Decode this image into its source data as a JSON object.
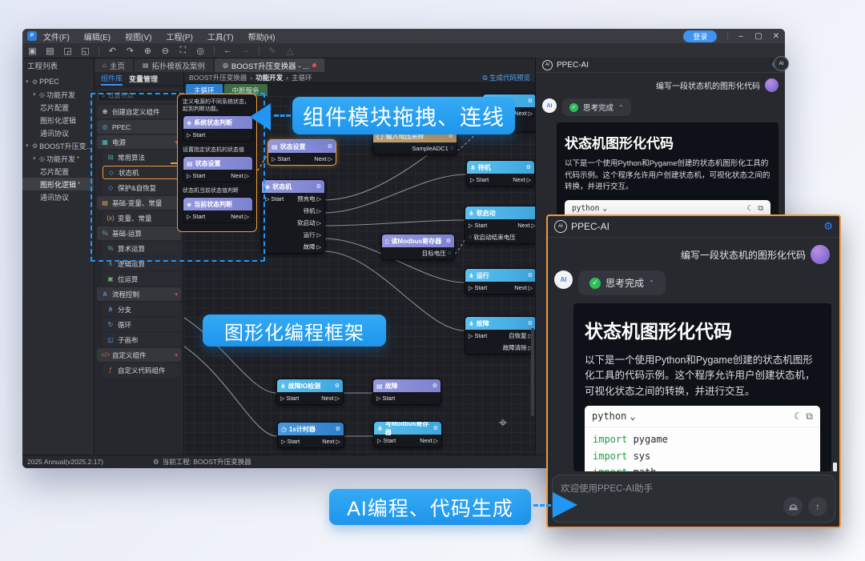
{
  "chrome": {
    "logo": "P",
    "menus": [
      "文件(F)",
      "编辑(E)",
      "视图(V)",
      "工程(P)",
      "工具(T)",
      "帮助(H)"
    ],
    "login_label": "登录",
    "window_controls": {
      "minimize": "–",
      "maximize": "▢",
      "close": "✕"
    }
  },
  "toolbar": {
    "icons": [
      {
        "name": "new-project-icon",
        "glyph": "▣"
      },
      {
        "name": "open-project-icon",
        "glyph": "▤"
      },
      {
        "name": "import-icon",
        "glyph": "◲"
      },
      {
        "name": "export-icon",
        "glyph": "◱"
      },
      {
        "name": "separator",
        "glyph": "|"
      },
      {
        "name": "undo-icon",
        "glyph": "↶"
      },
      {
        "name": "redo-icon",
        "glyph": "↷"
      },
      {
        "name": "zoom-in-icon",
        "glyph": "⊕"
      },
      {
        "name": "zoom-out-icon",
        "glyph": "⊖"
      },
      {
        "name": "fit-view-icon",
        "glyph": "⛶"
      },
      {
        "name": "locate-icon",
        "glyph": "◎"
      },
      {
        "name": "separator",
        "glyph": "|"
      },
      {
        "name": "back-icon",
        "glyph": "←"
      },
      {
        "name": "forward-icon",
        "glyph": "→",
        "disabled": true
      },
      {
        "name": "separator",
        "glyph": "|"
      },
      {
        "name": "annotate-icon",
        "glyph": "✎",
        "disabled": true
      },
      {
        "name": "measure-icon",
        "glyph": "△",
        "disabled": true
      }
    ]
  },
  "tabs": [
    {
      "label": "主页",
      "icon": "⌂"
    },
    {
      "label": "拓扑模板及案例",
      "icon": "▤"
    },
    {
      "label": "BOOST升压变换器 - ...",
      "icon": "◎",
      "active": true,
      "modified": true
    }
  ],
  "project_panel": {
    "title": "工程列表",
    "tree": [
      {
        "label": "PPEC",
        "level": 0,
        "arrow": "▾",
        "icon": "⚙"
      },
      {
        "label": "功能开发",
        "level": 1,
        "arrow": "▾",
        "icon": "◎"
      },
      {
        "label": "芯片配置",
        "level": 2
      },
      {
        "label": "图形化逻辑",
        "level": 2
      },
      {
        "label": "通讯协议",
        "level": 2
      },
      {
        "label": "BOOST升压变...",
        "level": 0,
        "arrow": "▾",
        "icon": "⚙"
      },
      {
        "label": "功能开发",
        "level": 1,
        "arrow": "▾",
        "icon": "◎",
        "modified": true
      },
      {
        "label": "芯片配置",
        "level": 2
      },
      {
        "label": "图形化逻辑",
        "level": 2,
        "modified": true,
        "active": true
      },
      {
        "label": "通讯协议",
        "level": 2
      }
    ]
  },
  "component_panel": {
    "tabs": {
      "library": "组件库",
      "variables": "变量管理"
    },
    "search_placeholder": "过滤节点",
    "items": [
      {
        "label": "创建自定义组件",
        "kind": "action",
        "icon": "⊕",
        "color": "c-white"
      },
      {
        "label": "PPEC",
        "kind": "group",
        "icon": "◎",
        "color": "c-blue"
      },
      {
        "label": "电源",
        "kind": "group",
        "icon": "▦",
        "color": "c-teal",
        "collapse": true
      },
      {
        "label": "常用算法",
        "kind": "item",
        "icon": "⊟",
        "color": "c-teal"
      },
      {
        "label": "状态机",
        "kind": "item",
        "icon": "◇",
        "color": "c-blue",
        "selected": true
      },
      {
        "label": "保护&自恢复",
        "kind": "item",
        "icon": "◇",
        "color": "c-blue"
      },
      {
        "label": "基础-变量、常量",
        "kind": "group",
        "icon": "▤",
        "color": "c-orange"
      },
      {
        "label": "变量、常量",
        "kind": "item",
        "icon": "(x)",
        "color": "c-orange"
      },
      {
        "label": "基础-运算",
        "kind": "group",
        "icon": "%",
        "color": "c-green"
      },
      {
        "label": "算术运算",
        "kind": "item",
        "icon": "%",
        "color": "c-green"
      },
      {
        "label": "逻辑运算",
        "kind": "item",
        "icon": "∧",
        "color": "c-green"
      },
      {
        "label": "位运算",
        "kind": "item",
        "icon": "▣",
        "color": "c-green"
      },
      {
        "label": "流程控制",
        "kind": "group",
        "icon": "⋔",
        "color": "c-blue",
        "collapse": true
      },
      {
        "label": "分支",
        "kind": "item",
        "icon": "⋔",
        "color": "c-blue"
      },
      {
        "label": "循环",
        "kind": "item",
        "icon": "↻",
        "color": "c-blue"
      },
      {
        "label": "子画布",
        "kind": "item",
        "icon": "◱",
        "color": "c-blue"
      },
      {
        "label": "自定义组件",
        "kind": "group",
        "icon": "</>",
        "color": "c-red",
        "collapse": true
      },
      {
        "label": "自定义代码组件",
        "kind": "item",
        "icon": "ƒ",
        "color": "c-red"
      }
    ]
  },
  "popup": {
    "sections": [
      {
        "desc": "定义电源的不同系统状态，起到判断功能。",
        "node": {
          "title": "系统状态判断",
          "theme": "purple",
          "icon": "◈",
          "rows": [
            {
              "l": "Start"
            }
          ]
        }
      },
      {
        "desc": "设置指定状态机的状态值",
        "node": {
          "title": "状态设置",
          "theme": "purple",
          "icon": "▤",
          "rows": [
            {
              "l": "Start",
              "r": "Next"
            }
          ]
        }
      },
      {
        "desc": "状态机当前状态值判断",
        "node": {
          "title": "当前状态判断",
          "theme": "purple",
          "icon": "◈",
          "rows": [
            {
              "l": "Start",
              "r": "Next"
            }
          ]
        }
      }
    ]
  },
  "canvas": {
    "breadcrumb": [
      "BOOST升压变换器",
      "功能开发",
      "主循环"
    ],
    "preview_link": "生成代码预览",
    "page_tabs": [
      {
        "label": "主循环",
        "color": "blue",
        "active": true
      },
      {
        "label": "中断服务",
        "color": "green"
      }
    ],
    "nodes": [
      {
        "id": "state-set",
        "title": "状态设置",
        "theme": "purple",
        "icon": "▤",
        "selected": true,
        "gear": true,
        "rows": [
          {
            "l": "Start",
            "r": "Next"
          }
        ]
      },
      {
        "id": "state-machine",
        "title": "状态机",
        "theme": "purple",
        "icon": "◈",
        "gear": true,
        "rows": [
          {
            "l": "Start",
            "r": "预充电"
          },
          {
            "r": "待机"
          },
          {
            "r": "软启动"
          },
          {
            "r": "运行"
          },
          {
            "r": "故障"
          }
        ]
      },
      {
        "id": "input-voltage-sample",
        "title": "输入电压采样",
        "theme": "orange",
        "icon": "{ }",
        "gear": true,
        "rows": [
          {
            "out": "SampleADC1"
          }
        ]
      },
      {
        "id": "partial-node",
        "title": "",
        "theme": "cyan",
        "icon": "",
        "gear": true,
        "rows": [
          {
            "r": "Next"
          },
          {
            "in": ""
          }
        ]
      },
      {
        "id": "standby",
        "title": "待机",
        "theme": "cyan",
        "icon": "⋔",
        "gear": true,
        "rows": [
          {
            "l": "Start",
            "r": "Next"
          }
        ]
      },
      {
        "id": "soft-start",
        "title": "软启动",
        "theme": "cyan",
        "icon": "⋔",
        "gear": false,
        "rows": [
          {
            "l": "Start",
            "r": "Next"
          },
          {
            "in": "软启动结束电压"
          }
        ]
      },
      {
        "id": "read-modbus",
        "title": "读Modbus寄存器",
        "theme": "purple",
        "icon": "▯",
        "gear": true,
        "rows": [
          {
            "out": "目标电压"
          }
        ]
      },
      {
        "id": "run",
        "title": "运行",
        "theme": "cyan",
        "icon": "⋔",
        "gear": true,
        "rows": [
          {
            "l": "Start",
            "r": "Next"
          }
        ]
      },
      {
        "id": "fault-states",
        "title": "故障",
        "theme": "cyan",
        "icon": "⋔",
        "gear": true,
        "rows": [
          {
            "l": "Start",
            "r": "自恢复"
          },
          {
            "r": "故障清除"
          }
        ]
      },
      {
        "id": "fault-io-detect",
        "title": "故障IO检测",
        "theme": "cyan",
        "icon": "⋔",
        "gear": true,
        "rows": [
          {
            "l": "Start",
            "r": "Next"
          }
        ]
      },
      {
        "id": "fault",
        "title": "故障",
        "theme": "purple",
        "icon": "▤",
        "gear": true,
        "rows": [
          {
            "l": "Start"
          }
        ]
      },
      {
        "id": "timer-1s",
        "title": "1s计时器",
        "theme": "blue",
        "icon": "◷",
        "gear": true,
        "rows": [
          {
            "l": "Start",
            "r": "Next"
          }
        ]
      },
      {
        "id": "write-modbus",
        "title": "写Modbus寄存器",
        "theme": "cyan",
        "icon": "⋔",
        "gear": true,
        "rows": [
          {
            "l": "Start",
            "r": "Next"
          }
        ]
      }
    ]
  },
  "callouts": {
    "drag": "组件模块拖拽、连线",
    "framework": "图形化编程框架",
    "ai": "AI编程、代码生成"
  },
  "ai": {
    "title": "PPEC-AI",
    "logo": "AI",
    "user_message": "编写一段状态机的图形化代码",
    "thinking_done": "思考完成",
    "answer_title": "状态机图形化代码",
    "answer_text": "以下是一个使用Python和Pygame创建的状态机图形化工具的代码示例。这个程序允许用户创建状态机，可视化状态之间的转换，并进行交互。",
    "code": {
      "lang": "python",
      "lines": [
        "import pygame",
        "import sys",
        "import math"
      ]
    },
    "input_placeholder": "欢迎使用PPEC-AI助手"
  },
  "status_bar": {
    "version": "2025 Annual(v2025.2.17)",
    "project": "当前工程: BOOST升压变换器"
  }
}
